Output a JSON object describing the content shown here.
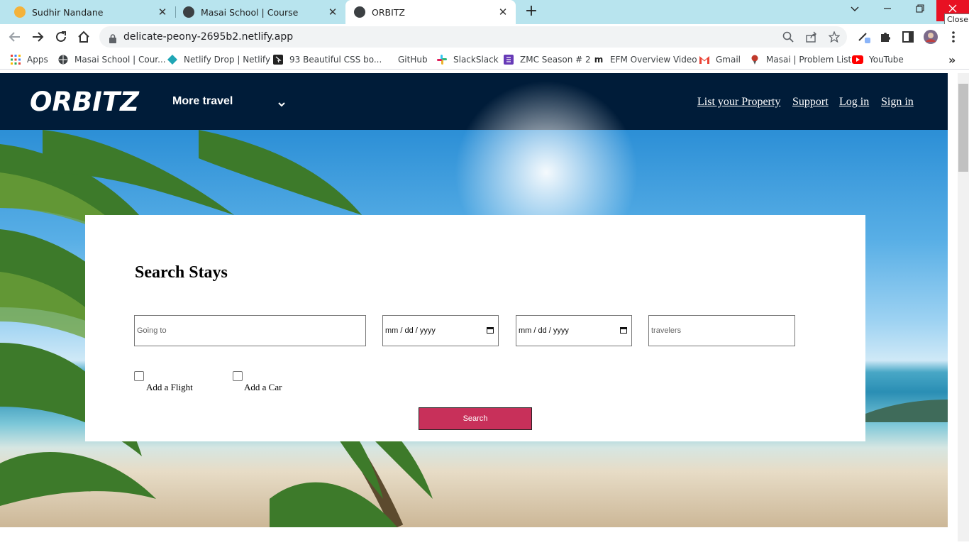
{
  "browser": {
    "tabs": [
      {
        "title": "Sudhir Nandane",
        "close": "✕"
      },
      {
        "title": "Masai School | Course",
        "close": "✕"
      },
      {
        "title": "ORBITZ",
        "close": "✕"
      }
    ],
    "new_tab": "+",
    "tooltip": "Close",
    "url": "delicate-peony-2695b2.netlify.app",
    "bookmarks": [
      "Apps",
      "Masai School | Cour...",
      "Netlify Drop | Netlify",
      "93 Beautiful CSS bo...",
      "GitHub",
      "SlackSlack",
      "ZMC Season # 2",
      "EFM Overview Video",
      "Gmail",
      "Masai | Problem List",
      "YouTube"
    ],
    "bookmarks_overflow": "»"
  },
  "site": {
    "logo": "ORBITZ",
    "more_travel": "More travel",
    "nav_links": [
      "List your Property",
      "Support",
      "Log in",
      "Sign in"
    ]
  },
  "search": {
    "title": "Search Stays",
    "going_to_placeholder": "Going to",
    "checkin_placeholder": "mm / dd / yyyy",
    "checkout_placeholder": "mm / dd / yyyy",
    "travelers_placeholder": "travelers",
    "add_flight_label": "Add a Flight",
    "add_car_label": "Add a Car",
    "search_button": "Search"
  },
  "colors": {
    "nav_bg": "#001c39",
    "search_button": "#c8305a",
    "tab_strip": "#b8e4ee"
  }
}
